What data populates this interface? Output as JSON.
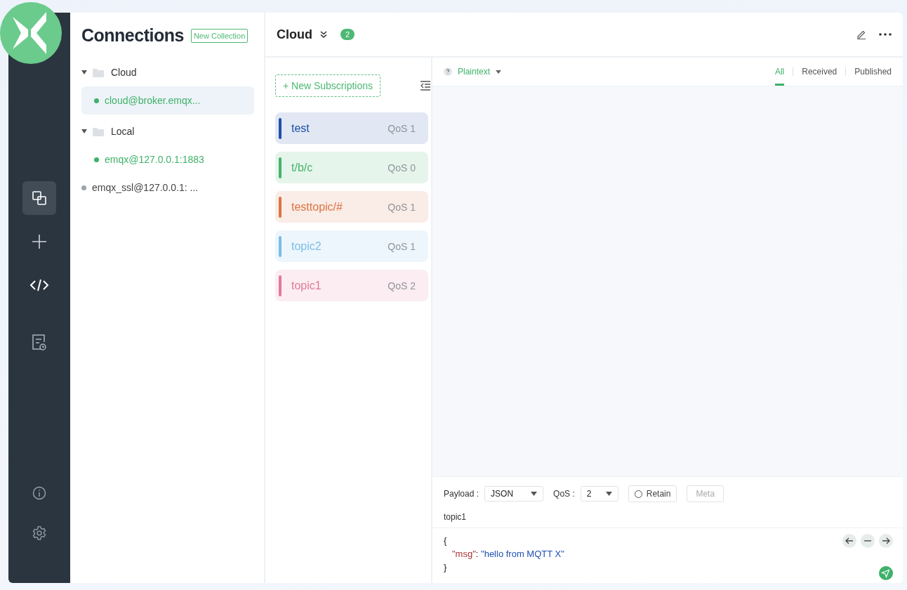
{
  "nav": {
    "items": [
      {
        "kind": "connections",
        "selected": true
      },
      {
        "kind": "new",
        "selected": false
      },
      {
        "kind": "script",
        "selected": false
      },
      {
        "kind": "log",
        "selected": false
      }
    ],
    "bottom": [
      {
        "kind": "about"
      },
      {
        "kind": "settings"
      }
    ]
  },
  "connections": {
    "title": "Connections",
    "new_collection": "New Collection",
    "groups": [
      {
        "name": "Cloud",
        "expanded": true,
        "children": [
          {
            "name": "cloud@broker.emqx...",
            "online": true,
            "selected": true
          }
        ]
      },
      {
        "name": "Local",
        "expanded": true,
        "children": [
          {
            "name": "emqx@127.0.0.1:1883",
            "online": true,
            "selected": false
          }
        ]
      }
    ],
    "items": [
      {
        "name": "emqx_ssl@127.0.0.1: ...",
        "online": false,
        "selected": false
      }
    ]
  },
  "header": {
    "title": "Cloud",
    "badge": "2"
  },
  "subscriptions": {
    "new_button": "+ New Subscriptions",
    "items": [
      {
        "topic": "test",
        "qos": "QoS 1",
        "color": "#1f4fa8"
      },
      {
        "topic": "t/b/c",
        "qos": "QoS 0",
        "color": "#44b36a"
      },
      {
        "topic": "testtopic/#",
        "qos": "QoS 1",
        "color": "#dc7346"
      },
      {
        "topic": "topic2",
        "qos": "QoS 1",
        "color": "#7bbde6"
      },
      {
        "topic": "topic1",
        "qos": "QoS 2",
        "color": "#e07a99"
      }
    ]
  },
  "messages": {
    "format": "Plaintext",
    "filters": [
      {
        "label": "All",
        "selected": true
      },
      {
        "label": "Received",
        "selected": false
      },
      {
        "label": "Published",
        "selected": false
      }
    ]
  },
  "publish": {
    "payload_label": "Payload :",
    "payload_type": "JSON",
    "qos_label": "QoS :",
    "qos": "2",
    "retain": {
      "label": "Retain",
      "checked": false
    },
    "meta": "Meta",
    "topic": "topic1",
    "payload": {
      "open": "{",
      "key": "\"msg\"",
      "colon": ":",
      "value": "\"hello from MQTT X\"",
      "close": "}"
    }
  }
}
